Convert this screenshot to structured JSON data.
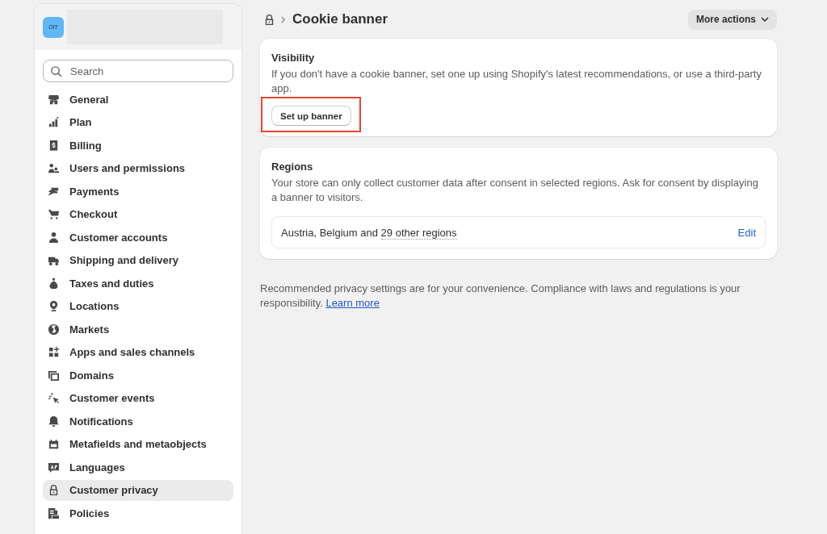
{
  "sidebar": {
    "store_badge": "OIT",
    "search": {
      "placeholder": "Search"
    },
    "items": [
      {
        "label": "General",
        "selected": false
      },
      {
        "label": "Plan",
        "selected": false
      },
      {
        "label": "Billing",
        "selected": false
      },
      {
        "label": "Users and permissions",
        "selected": false
      },
      {
        "label": "Payments",
        "selected": false
      },
      {
        "label": "Checkout",
        "selected": false
      },
      {
        "label": "Customer accounts",
        "selected": false
      },
      {
        "label": "Shipping and delivery",
        "selected": false
      },
      {
        "label": "Taxes and duties",
        "selected": false
      },
      {
        "label": "Locations",
        "selected": false
      },
      {
        "label": "Markets",
        "selected": false
      },
      {
        "label": "Apps and sales channels",
        "selected": false
      },
      {
        "label": "Domains",
        "selected": false
      },
      {
        "label": "Customer events",
        "selected": false
      },
      {
        "label": "Notifications",
        "selected": false
      },
      {
        "label": "Metafields and metaobjects",
        "selected": false
      },
      {
        "label": "Languages",
        "selected": false
      },
      {
        "label": "Customer privacy",
        "selected": true
      },
      {
        "label": "Policies",
        "selected": false
      }
    ]
  },
  "header": {
    "title": "Cookie banner",
    "more_actions": "More actions"
  },
  "visibility_card": {
    "title": "Visibility",
    "description": "If you don't have a cookie banner, set one up using Shopify's latest recommendations, or use a third-party app.",
    "button": {
      "label": "Set up banner",
      "highlighted": true
    }
  },
  "regions_card": {
    "title": "Regions",
    "description": "Your store can only collect customer data after consent in selected regions. Ask for consent by displaying a banner to visitors.",
    "summary": "Austria, Belgium and",
    "summary_link": "29 other regions",
    "edit": "Edit"
  },
  "footer": {
    "text": "Recommended privacy settings are for your convenience. Compliance with laws and regulations is your responsibility.",
    "link": "Learn more"
  }
}
